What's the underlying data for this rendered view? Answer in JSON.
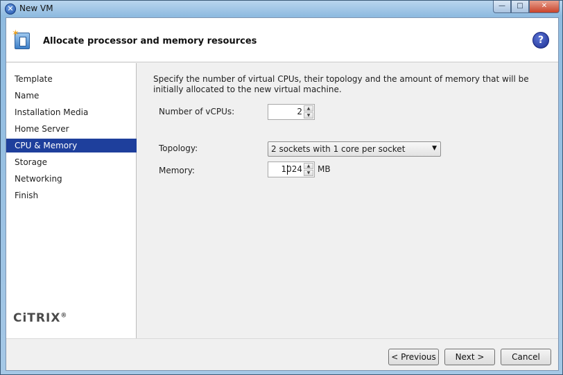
{
  "window": {
    "title": "New VM",
    "close_glyph": "✕",
    "min_glyph": "—",
    "max_glyph": "□"
  },
  "header": {
    "title": "Allocate processor and memory resources",
    "help_glyph": "?"
  },
  "sidebar": {
    "items": [
      {
        "label": "Template"
      },
      {
        "label": "Name"
      },
      {
        "label": "Installation Media"
      },
      {
        "label": "Home Server"
      },
      {
        "label": "CPU & Memory",
        "active": true
      },
      {
        "label": "Storage"
      },
      {
        "label": "Networking"
      },
      {
        "label": "Finish"
      }
    ],
    "logo_text": "CiTRIX",
    "logo_mark": "®"
  },
  "main": {
    "description": "Specify the number of virtual CPUs, their topology and the amount of memory that will be initially allocated to the new virtual machine.",
    "vcpus_label": "Number of vCPUs:",
    "vcpus_value": "2",
    "topology_label": "Topology:",
    "topology_value": "2 sockets with 1 core per socket",
    "memory_label": "Memory:",
    "memory_value": "1024",
    "memory_unit": "MB"
  },
  "footer": {
    "previous": "< Previous",
    "next": "Next >",
    "cancel": "Cancel"
  },
  "icons": {
    "app": "app-icon",
    "wizard": "vm-wizard-icon",
    "help": "help-icon",
    "spinner_up": "▲",
    "spinner_down": "▼",
    "dropdown": "▼"
  },
  "colors": {
    "selection": "#1e3f9c",
    "help": "#1d2f91"
  }
}
